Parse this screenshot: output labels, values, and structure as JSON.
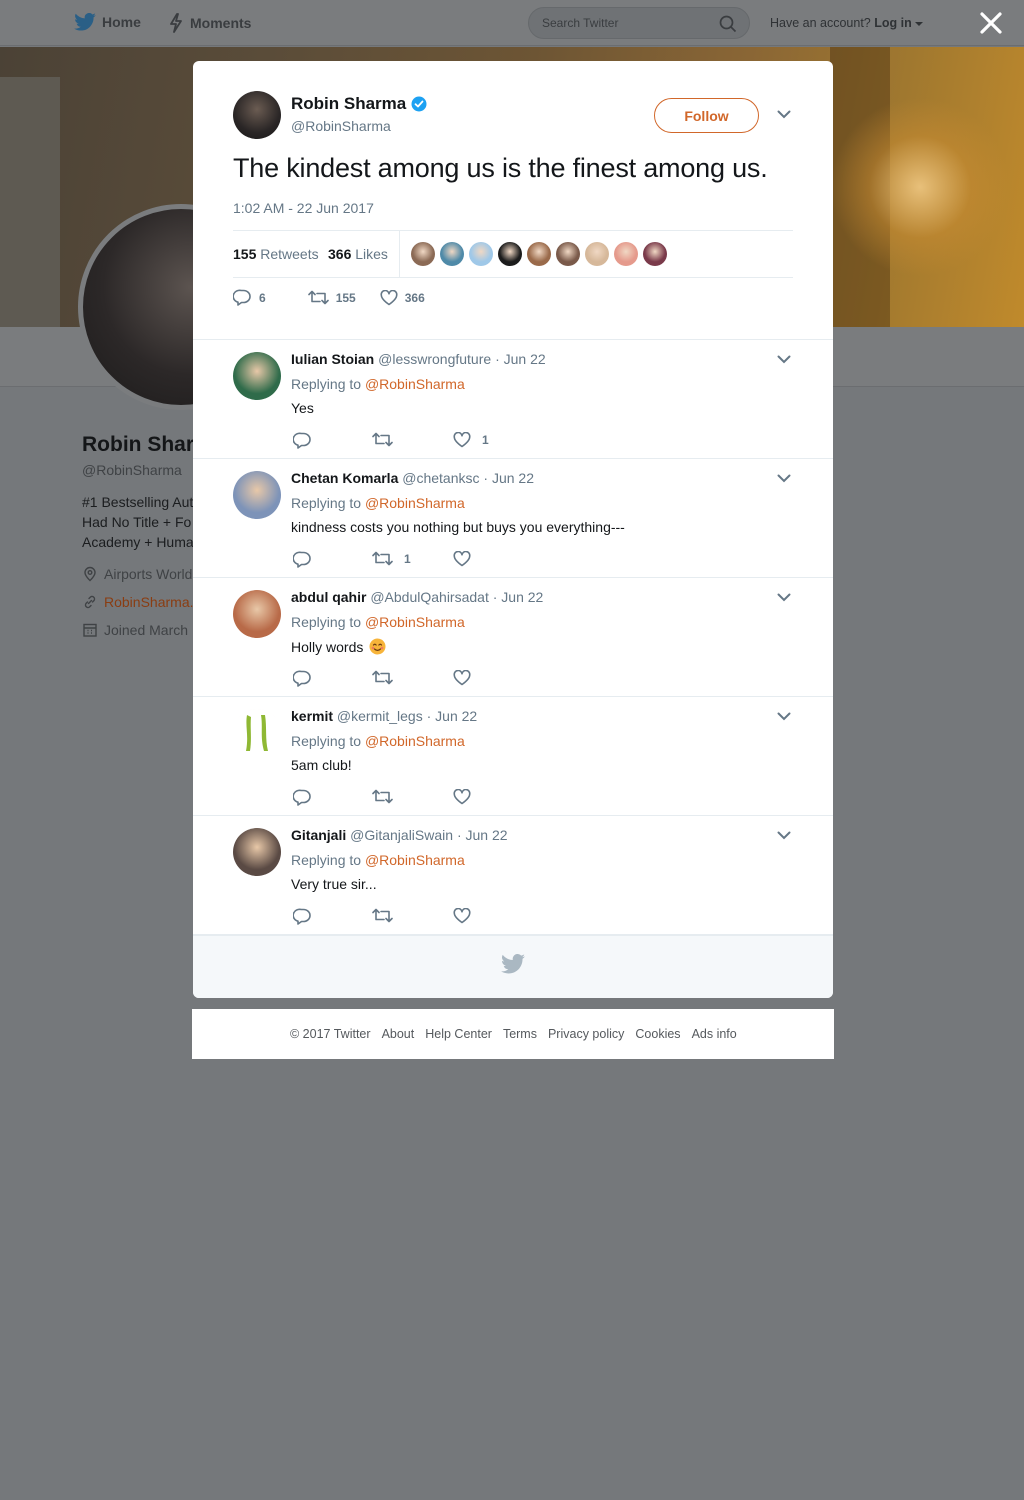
{
  "nav": {
    "home_label": "Home",
    "moments_label": "Moments",
    "search_placeholder": "Search Twitter",
    "have_account": "Have an account?",
    "login_label": "Log in"
  },
  "profile": {
    "name": "Robin Shar",
    "handle": "@RobinSharma",
    "bio_lines": [
      "#1 Bestselling Aut",
      "Had No Title + Fo",
      "Academy + Huma"
    ],
    "location": "Airports World",
    "website": "RobinSharma.",
    "joined": "Joined March"
  },
  "tweet": {
    "author_name": "Robin Sharma",
    "author_handle": "@RobinSharma",
    "follow_label": "Follow",
    "text": "The kindest among us is the finest among us.",
    "timestamp": "1:02 AM - 22 Jun 2017",
    "retweets_count": "155",
    "retweets_label": "Retweets",
    "likes_count": "366",
    "likes_label": "Likes",
    "reply_count": "6",
    "retweet_count": "155",
    "like_count": "366"
  },
  "liker_colors": [
    "#8b6a55",
    "#4f8aa8",
    "#9fc8e8",
    "#1c1c1c",
    "#9a6a4a",
    "#7a5a4a",
    "#d6b89a",
    "#e59a8c",
    "#7a3a4a"
  ],
  "replies": [
    {
      "name": "Iulian Stoian",
      "handle": "@lesswrongfuture",
      "date": "· Jun 22",
      "replying_label": "Replying to",
      "replying_to": "@RobinSharma",
      "text": "Yes",
      "emoji": "",
      "reply_n": "",
      "rt_n": "",
      "like_n": "1",
      "avatar_color": "#2f6b4a"
    },
    {
      "name": "Chetan Komarla",
      "handle": "@chetanksc",
      "date": "· Jun 22",
      "replying_label": "Replying to",
      "replying_to": "@RobinSharma",
      "text": "kindness costs you nothing but buys you everything---",
      "emoji": "",
      "reply_n": "",
      "rt_n": "1",
      "like_n": "",
      "avatar_color": "#7d93b8"
    },
    {
      "name": "abdul qahir",
      "handle": "@AbdulQahirsadat",
      "date": "· Jun 22",
      "replying_label": "Replying to",
      "replying_to": "@RobinSharma",
      "text": "Holly words",
      "emoji": "😊",
      "reply_n": "",
      "rt_n": "",
      "like_n": "",
      "avatar_color": "#b86a48"
    },
    {
      "name": "kermit",
      "handle": "@kermit_legs",
      "date": "· Jun 22",
      "replying_label": "Replying to",
      "replying_to": "@RobinSharma",
      "text": "5am club!",
      "emoji": "",
      "reply_n": "",
      "rt_n": "",
      "like_n": "",
      "avatar_color": "#ffffff"
    },
    {
      "name": "Gitanjali",
      "handle": "@GitanjaliSwain",
      "date": "· Jun 22",
      "replying_label": "Replying to",
      "replying_to": "@RobinSharma",
      "text": "Very true sir...",
      "emoji": "",
      "reply_n": "",
      "rt_n": "",
      "like_n": "",
      "avatar_color": "#5a4a44"
    }
  ],
  "footer_links": [
    "© 2017 Twitter",
    "About",
    "Help Center",
    "Terms",
    "Privacy policy",
    "Cookies",
    "Ads info"
  ],
  "colors": {
    "accent": "#d1672a",
    "verified": "#1da1f2",
    "muted": "#657786",
    "twitter_blue_dim": "#2a5f86"
  }
}
